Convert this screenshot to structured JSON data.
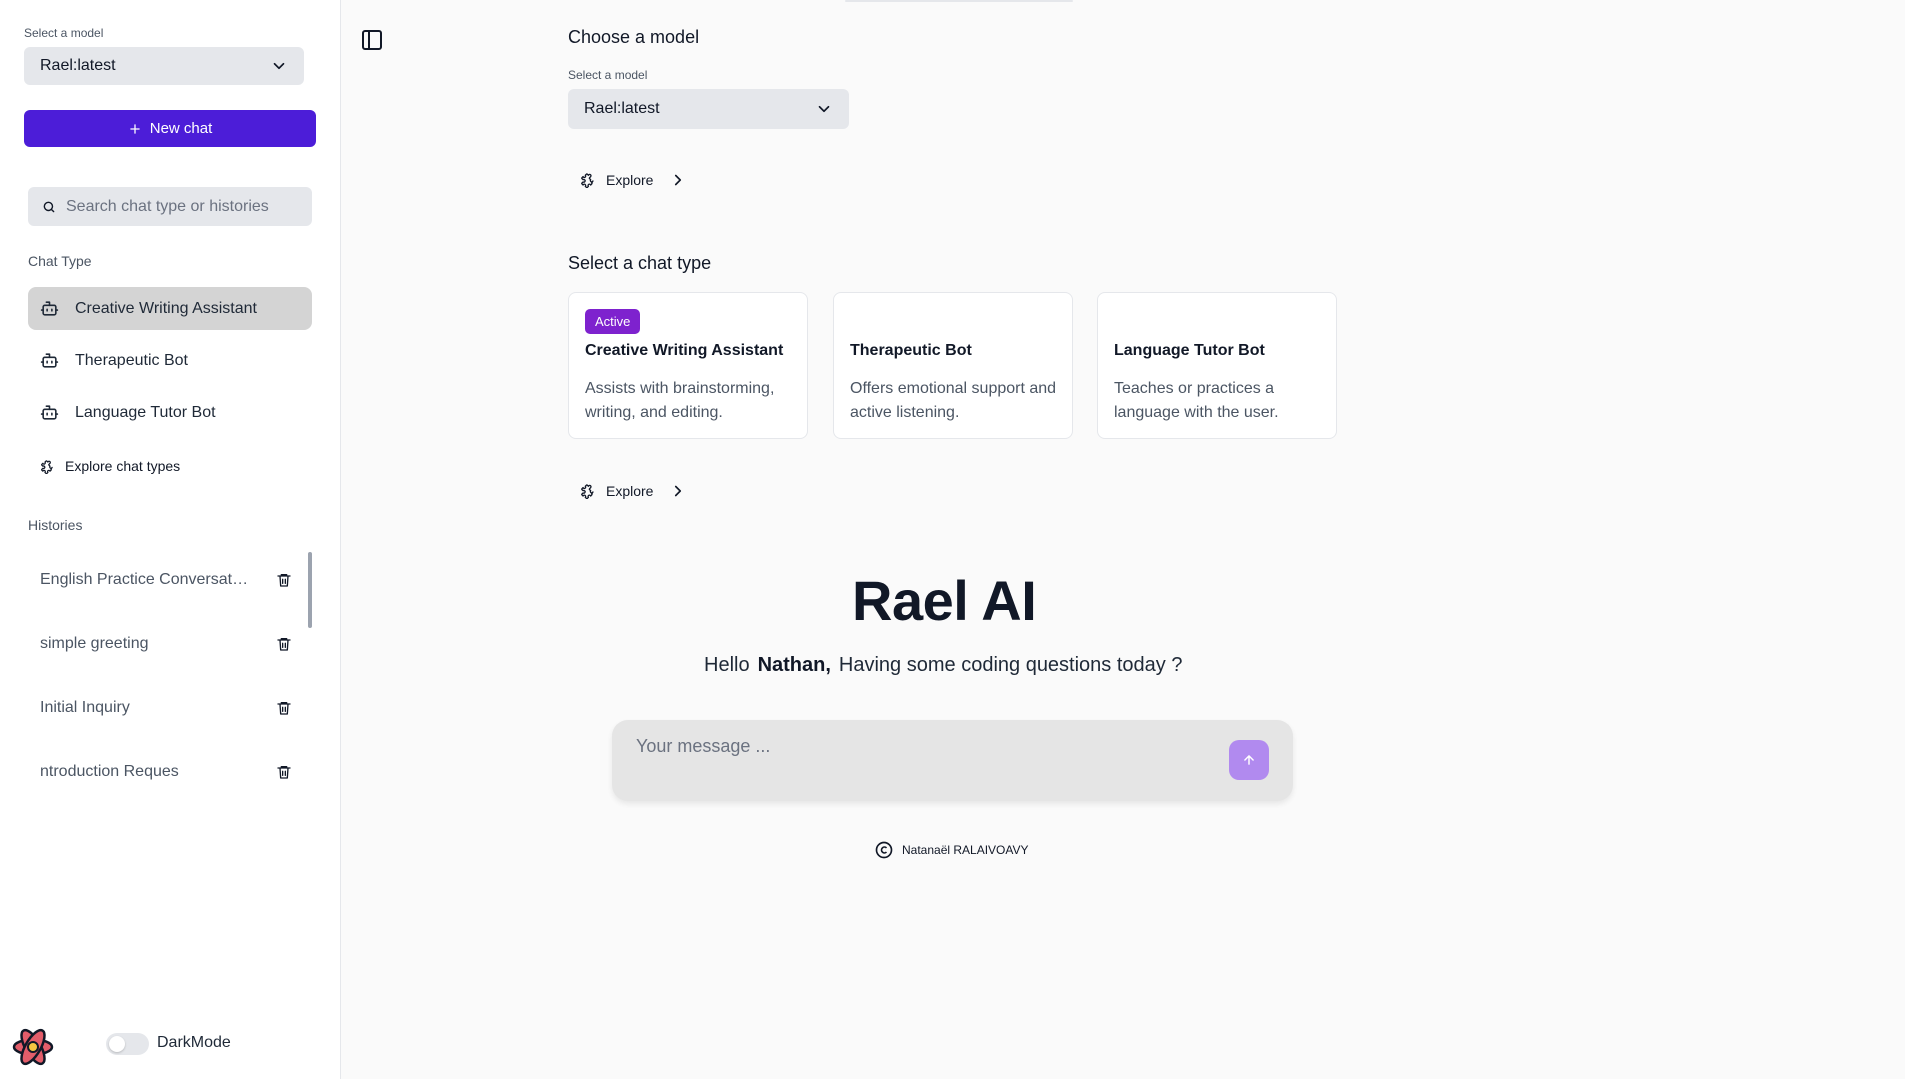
{
  "sidebar": {
    "model_label": "Select a model",
    "model_value": "Rael:latest",
    "new_chat_label": "New chat",
    "search_placeholder": "Search chat type or histories",
    "chat_type_title": "Chat Type",
    "chat_types": [
      {
        "label": "Creative Writing Assistant"
      },
      {
        "label": "Therapeutic Bot"
      },
      {
        "label": "Language Tutor Bot"
      }
    ],
    "explore_label": "Explore chat types",
    "histories_title": "Histories",
    "histories": [
      {
        "label": "English Practice Conversation"
      },
      {
        "label": "simple greeting"
      },
      {
        "label": "Initial Inquiry"
      },
      {
        "label": "ntroduction Reques"
      }
    ],
    "dark_mode_label": "DarkMode"
  },
  "main": {
    "choose_model_title": "Choose a model",
    "model_label": "Select a model",
    "model_value": "Rael:latest",
    "explore_label": "Explore",
    "chat_type_title": "Select a chat type",
    "cards": [
      {
        "badge": "Active",
        "title": "Creative Writing Assistant",
        "desc": "Assists with brainstorming, writing, and editing."
      },
      {
        "title": "Therapeutic Bot",
        "desc": "Offers emotional support and active listening."
      },
      {
        "title": "Language Tutor Bot",
        "desc": "Teaches or practices a language with the user."
      }
    ],
    "explore_label_2": "Explore",
    "brand_title": "Rael AI",
    "greeting_hello": "Hello",
    "greeting_name": "Nathan,",
    "greeting_rest": "Having some coding questions today ?",
    "message_placeholder": "Your message ...",
    "footer_text": "Natanaël RALAIVOAVY"
  },
  "colors": {
    "primary": "#4c1dd8",
    "badge": "#7e22ce",
    "send_button": "#b18aef",
    "active_chat_bg": "#d4d4d4"
  },
  "icons": [
    "chevron-down-icon",
    "plus-icon",
    "search-icon",
    "bot-icon",
    "puzzle-icon",
    "trash-icon",
    "atom-logo-icon",
    "sidebar-panel-icon",
    "chevron-right-icon",
    "arrow-up-icon",
    "copyright-icon"
  ]
}
